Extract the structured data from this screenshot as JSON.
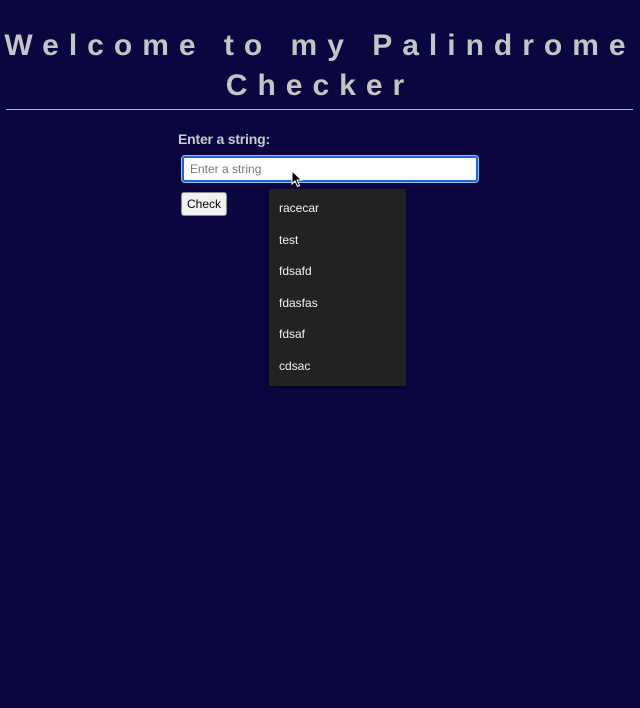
{
  "header": {
    "title_line1": "Welcome to my Palindrome",
    "title_line2": "Checker"
  },
  "form": {
    "label": "Enter a string:",
    "input_value": "",
    "input_placeholder": "Enter a string",
    "check_button": "Check"
  },
  "autocomplete": {
    "options": [
      "racecar",
      "test",
      "fdsafd",
      "fdasfas",
      "fdsaf",
      "cdsac"
    ]
  },
  "colors": {
    "background": "#0b0640",
    "title": "#c4c4c4",
    "dropdown_bg": "#222222",
    "focus_border": "#1b67d8"
  },
  "icons": {
    "cursor": "mouse-pointer-icon"
  }
}
